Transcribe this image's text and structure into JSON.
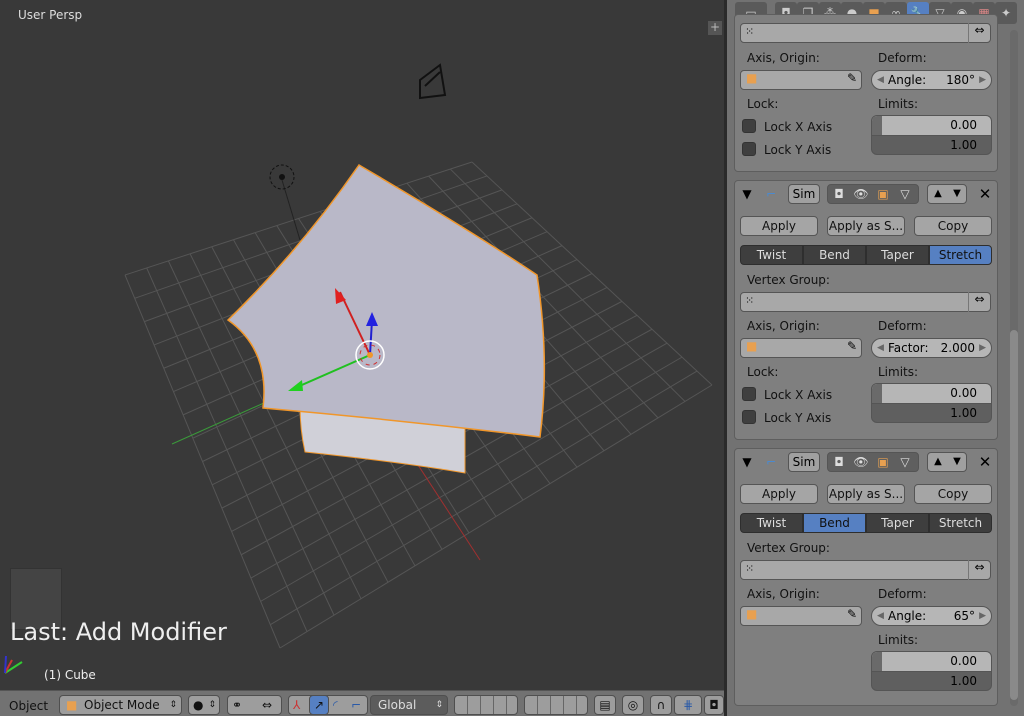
{
  "viewport": {
    "title": "User Persp",
    "last_operator": "Last: Add Modifier",
    "object_label": "(1) Cube"
  },
  "properties": {
    "tabs": [
      "render-icon",
      "render-layers-icon",
      "scene-icon",
      "world-icon",
      "object-icon",
      "constraints-icon",
      "modifiers-icon",
      "data-icon",
      "material-icon",
      "texture-icon",
      "particles-icon",
      "physics-icon"
    ],
    "active_tab": "modifiers-icon",
    "modifier1": {
      "axis_origin_label": "Axis, Origin:",
      "deform_label": "Deform:",
      "deform_field": "Angle:",
      "deform_value": "180°",
      "lock_label": "Lock:",
      "lock_x": "Lock X Axis",
      "lock_y": "Lock Y Axis",
      "limits_label": "Limits:",
      "limit_min": "0.00",
      "limit_max": "1.00"
    },
    "modifier2": {
      "name": "Sim",
      "apply": "Apply",
      "apply_as": "Apply as S...",
      "copy": "Copy",
      "modes": [
        "Twist",
        "Bend",
        "Taper",
        "Stretch"
      ],
      "active_mode": "Stretch",
      "vertex_group_label": "Vertex Group:",
      "axis_origin_label": "Axis, Origin:",
      "deform_label": "Deform:",
      "deform_field": "Factor:",
      "deform_value": "2.000",
      "lock_label": "Lock:",
      "lock_x": "Lock X Axis",
      "lock_y": "Lock Y Axis",
      "limits_label": "Limits:",
      "limit_min": "0.00",
      "limit_max": "1.00"
    },
    "modifier3": {
      "name": "Sim",
      "apply": "Apply",
      "apply_as": "Apply as S...",
      "copy": "Copy",
      "modes": [
        "Twist",
        "Bend",
        "Taper",
        "Stretch"
      ],
      "active_mode": "Bend",
      "vertex_group_label": "Vertex Group:",
      "axis_origin_label": "Axis, Origin:",
      "deform_label": "Deform:",
      "deform_field": "Angle:",
      "deform_value": "65°",
      "limits_label": "Limits:",
      "limit_min": "0.00",
      "limit_max": "1.00"
    }
  },
  "bottombar": {
    "menu": "Object",
    "mode": "Object Mode",
    "orientation": "Global"
  },
  "colors": {
    "accent": "#5680c2",
    "selection": "#f0962a",
    "viewport_bg": "#393939"
  }
}
